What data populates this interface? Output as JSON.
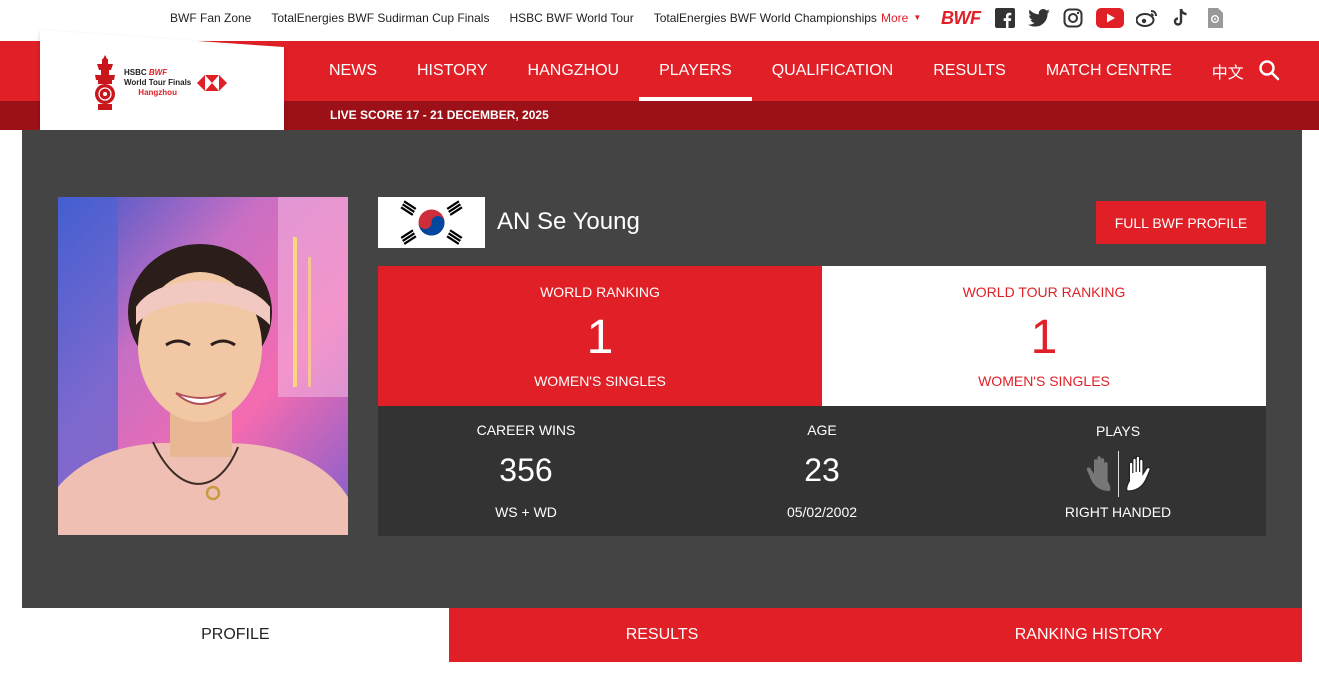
{
  "top_links": [
    "BWF Fan Zone",
    "TotalEnergies BWF Sudirman Cup Finals",
    "HSBC BWF World Tour",
    "TotalEnergies BWF World Championships"
  ],
  "top_more": "More",
  "brand": {
    "bwf_logo": "BWF",
    "accent": "#e01f26",
    "dark_red": "#9c1117"
  },
  "socials": [
    "facebook-icon",
    "twitter-icon",
    "instagram-icon",
    "youtube-icon",
    "weibo-icon",
    "tiktok-icon",
    "wechat-icon"
  ],
  "event_logo": {
    "line1_prefix": "HSBC",
    "line1_brand": "BWF",
    "line2": "World Tour Finals",
    "line3": "Hangzhou"
  },
  "nav": [
    "NEWS",
    "HISTORY",
    "HANGZHOU",
    "PLAYERS",
    "QUALIFICATION",
    "RESULTS",
    "MATCH CENTRE",
    "中文"
  ],
  "nav_active": "PLAYERS",
  "live_score": "LIVE SCORE 17 - 21 DECEMBER, 2025",
  "player": {
    "name": "AN Se Young",
    "flag": "south-korea-flag",
    "profile_button": "FULL BWF PROFILE"
  },
  "rankings": {
    "world": {
      "label": "WORLD RANKING",
      "value": "1",
      "category": "WOMEN'S SINGLES"
    },
    "world_tour": {
      "label": "WORLD TOUR RANKING",
      "value": "1",
      "category": "WOMEN'S SINGLES"
    }
  },
  "stats": {
    "career": {
      "label": "CAREER WINS",
      "value": "356",
      "sub": "WS + WD"
    },
    "age": {
      "label": "AGE",
      "value": "23",
      "sub": "05/02/2002"
    },
    "plays": {
      "label": "PLAYS",
      "sub": "RIGHT HANDED"
    }
  },
  "tabs": [
    "PROFILE",
    "RESULTS",
    "RANKING HISTORY"
  ]
}
